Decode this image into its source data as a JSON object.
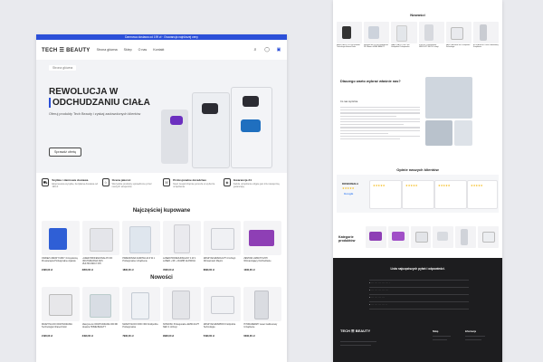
{
  "promo_bar": "Darmowa dostawa od 199 zł · Gwarancja najniższej ceny",
  "nav": {
    "logo": "TECH ☰ BEAUTY",
    "links": [
      "Strona główna",
      "Sklep",
      "O nas",
      "Kontakt"
    ]
  },
  "hero": {
    "breadcrumb": "Strona główna",
    "title_line1": "REWOLUCJA W",
    "title_line2a": "ODCHUDZANIU",
    "title_line2b": "CIAŁA",
    "subtitle": "Oferuj produkty Tech Beauty i zyskaj zadowolonych klientów",
    "button": "Sprawdź ofertę"
  },
  "features": [
    {
      "title": "Szybka i darmowa dostawa",
      "desc": "Ekspresowa wysyłka, bezpłatna dostawa od 199 zł"
    },
    {
      "title": "Ocena jakości",
      "desc": "Wszystkie produkty sprawdzone przez naszych ekspertów"
    },
    {
      "title": "Profesjonalne doradztwo",
      "desc": "Nasz zespół chętnie pomoże w wyborze urządzenia"
    },
    {
      "title": "Gwarancja 24",
      "desc": "Każde urządzenie objęte jest 24-miesięczną gwarancją"
    }
  ],
  "best": {
    "title": "Najczęściej kupowane",
    "items": [
      {
        "name": "ODZIEŻ LIMFATYCZNY 3-Częściowy Presoterapia Profesjonalne Aparatu",
        "price": "2490,00 zł"
      },
      {
        "name": "LASER PROFESJONALNY DO ODCHUDZANIA 3W1 MULTIFUNKCYJNY",
        "price": "3950,00 zł"
      },
      {
        "name": "PRZENOŚNA KAWITACJA 6 W 1 Profesjonalne Urządzenie",
        "price": "1890,00 zł"
      },
      {
        "name": "LASER PROFESJONALNY 4 W 1 LASER + RF + RAMIĘ GŁOWICA",
        "price": "4590,00 zł"
      },
      {
        "name": "MASZYNA EMSCULPT 4 Uchwyt Wzmacniacz Mięśni",
        "price": "8990,00 zł"
      },
      {
        "name": "ZESTAW LIMFATYCZNY Wzmacniający Odchudzanie",
        "price": "1290,00 zł"
      }
    ]
  },
  "news": {
    "title": "Nowości",
    "items": [
      {
        "name": "MASZYNA DO ODCHUDZANIA Technologia Infrared Kolor",
        "price": "2190,00 zł"
      },
      {
        "name": "Maszyna do ODCHUDZANIA 360 RF Głowica HOME BEAUTY",
        "price": "3490,00 zł"
      },
      {
        "name": "MASZYNA DO KRIO 360 Kriolipoliza Profesjonalna",
        "price": "7990,00 zł"
      },
      {
        "name": "NOWOŚĆ Profesjonalne EMSCULPT NEO 4 Uchwyt",
        "price": "9990,00 zł"
      },
      {
        "name": "MASZYNA EMSPIRO Kriolipoliza Technologia",
        "price": "5490,00 zł"
      },
      {
        "name": "HYDRADERMY Laser Gabinetowy Urządzenie",
        "price": "6290,00 zł"
      }
    ]
  },
  "right": {
    "news_title": "Nowości",
    "why_title": "Dlaczego warto wybrać właśnie nas?",
    "why_sub": "Co nas wyróżnia",
    "reviews_title": "Opinie naszych klientów",
    "reviews_brand": "DOSKONAŁA",
    "reviews_google": "Google",
    "categories_title": "Kategorie produktów",
    "faq_title": "Lista najczęstszych pytań i odpowiedzi.",
    "footer_logo": "TECH ☰ BEAUTY",
    "footer_col1": "Sklep",
    "footer_col2": "Informacje"
  },
  "colors": {
    "accent": "#2b4fd8",
    "purple": "#8e3fb5",
    "dark_footer": "#1d1d1f"
  }
}
